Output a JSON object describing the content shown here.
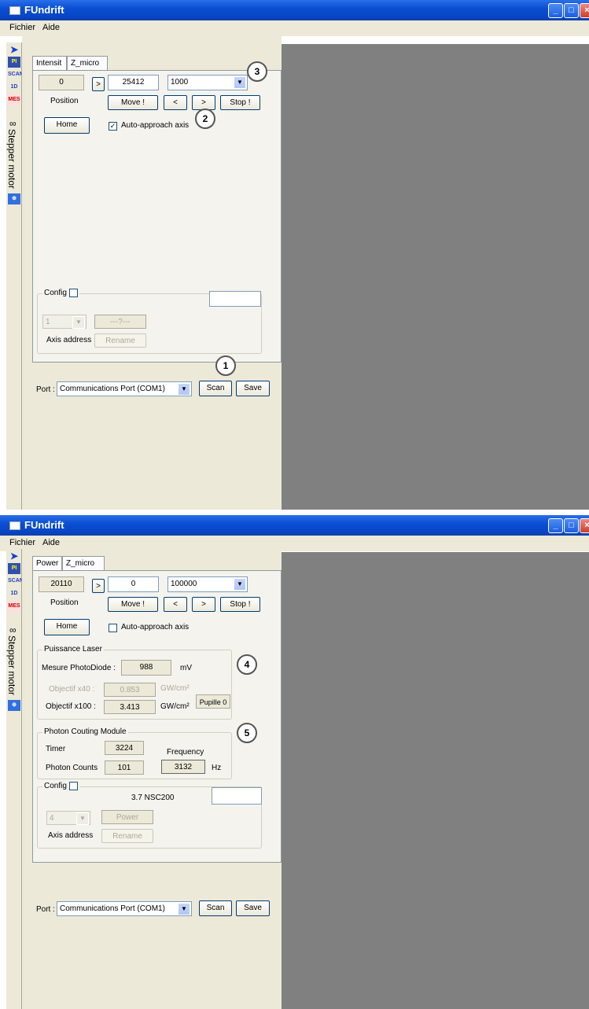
{
  "windows": [
    {
      "title": "FUndrift",
      "menu": [
        "Fichier",
        "Aide"
      ],
      "sidebar": {
        "icons": [
          "PI",
          "SCAN",
          "1D",
          "MES"
        ],
        "vertical_label": "Stepper motor"
      },
      "tabs": [
        "Intensit",
        "Z_micro"
      ],
      "position_readout": "0",
      "goto_arrow": ">",
      "target_value": "25412",
      "step_select": "1000",
      "position_label": "Position",
      "move_button": "Move !",
      "step_back_button": "<",
      "step_fwd_button": ">",
      "stop_button": "Stop !",
      "home_button": "Home",
      "auto_approach": {
        "label": "Auto-approach axis",
        "checked": true
      },
      "config": {
        "label": "Config",
        "checked": false,
        "axis_select": "1",
        "name_field": "---?---",
        "axis_address_label": "Axis address",
        "rename_button": "Rename"
      },
      "port": {
        "label": "Port :",
        "value": "Communications Port (COM1)"
      },
      "scan_button": "Scan",
      "save_button": "Save",
      "markers": [
        "3",
        "2",
        "1"
      ]
    },
    {
      "title": "FUndrift",
      "menu": [
        "Fichier",
        "Aide"
      ],
      "sidebar": {
        "icons": [
          "PI",
          "SCAN",
          "1D",
          "MES"
        ],
        "vertical_label": "Stepper motor"
      },
      "tabs": [
        "Power",
        "Z_micro"
      ],
      "position_readout": "20110",
      "goto_arrow": ">",
      "target_value": "0",
      "step_select": "100000",
      "position_label": "Position",
      "move_button": "Move !",
      "step_back_button": "<",
      "step_fwd_button": ">",
      "stop_button": "Stop !",
      "home_button": "Home",
      "auto_approach": {
        "label": "Auto-approach axis",
        "checked": false
      },
      "laser": {
        "title": "Puissance Laser",
        "photodiode_label": "Mesure PhotoDiode :",
        "photodiode_value": "988",
        "photodiode_unit": "mV",
        "obj40_label": "Objectif x40 :",
        "obj40_value": "0.853",
        "obj40_unit": "GW/cm²",
        "obj100_label": "Objectif x100 :",
        "obj100_value": "3.413",
        "obj100_unit": "GW/cm²",
        "pupille": "Pupille 0"
      },
      "photon": {
        "title": "Photon Couting Module",
        "timer_label": "Timer",
        "timer_value": "3224",
        "frequency_label": "Frequency",
        "counts_label": "Photon Counts",
        "counts_value": "101",
        "frequency_value": "3132",
        "frequency_unit": "Hz"
      },
      "config": {
        "label": "Config",
        "checked": false,
        "device": "3.7 NSC200",
        "axis_select": "4",
        "name_field": "Power",
        "axis_address_label": "Axis address",
        "rename_button": "Rename"
      },
      "port": {
        "label": "Port :",
        "value": "Communications Port (COM1)"
      },
      "scan_button": "Scan",
      "save_button": "Save",
      "markers": [
        "4",
        "5"
      ]
    }
  ]
}
